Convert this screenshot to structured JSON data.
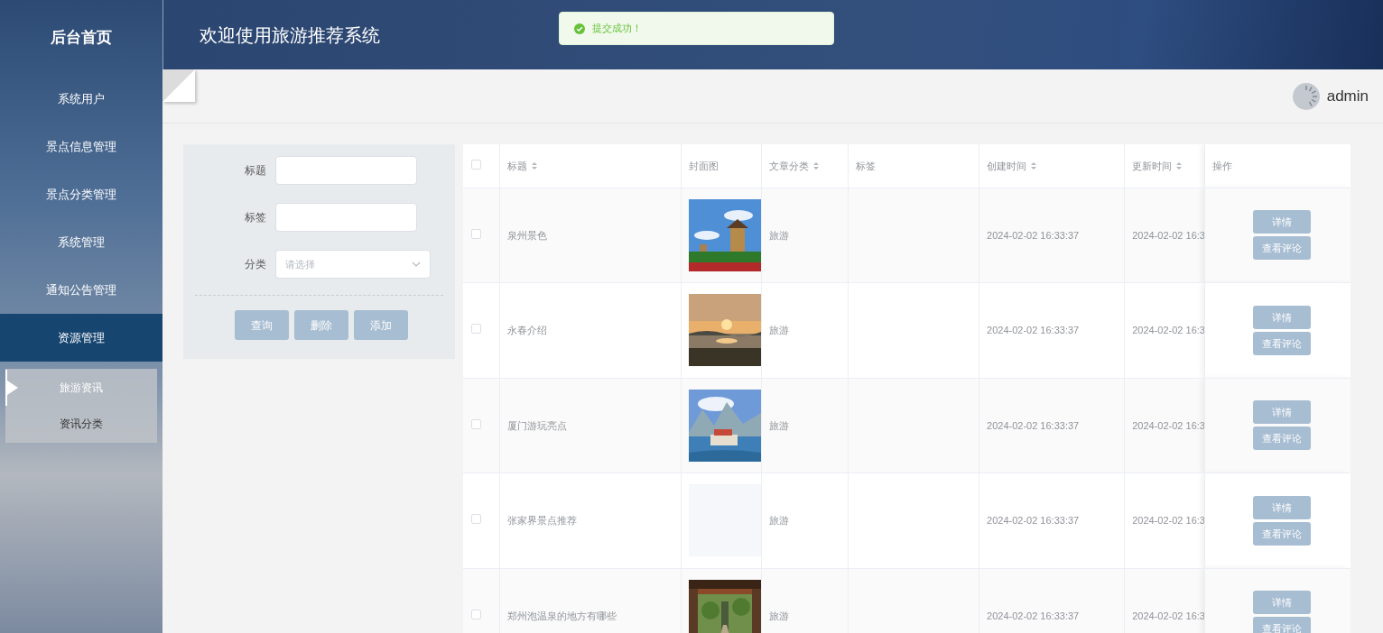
{
  "sidebar": {
    "title": "后台首页",
    "items": [
      {
        "label": "系统用户",
        "selected": false
      },
      {
        "label": "景点信息管理",
        "selected": false
      },
      {
        "label": "景点分类管理",
        "selected": false
      },
      {
        "label": "系统管理",
        "selected": false
      },
      {
        "label": "通知公告管理",
        "selected": false
      },
      {
        "label": "资源管理",
        "selected": true,
        "children": [
          {
            "label": "旅游资讯",
            "selected": true
          },
          {
            "label": "资讯分类",
            "selected": false
          }
        ]
      }
    ]
  },
  "header": {
    "title": "欢迎使用旅游推荐系统"
  },
  "toast": {
    "kind": "success",
    "text": "提交成功！"
  },
  "user": {
    "name": "admin"
  },
  "search_form": {
    "fields": [
      {
        "kind": "input",
        "label": "标题"
      },
      {
        "kind": "input",
        "label": "标签"
      },
      {
        "kind": "select",
        "label": "分类",
        "placeholder": "请选择"
      }
    ],
    "buttons": [
      "查询",
      "删除",
      "添加"
    ]
  },
  "table": {
    "all_checked": false,
    "columns": [
      {
        "label": "标题",
        "sortable": true
      },
      {
        "label": "封面图",
        "sortable": false
      },
      {
        "label": "文章分类",
        "sortable": true
      },
      {
        "label": "标签",
        "sortable": false
      },
      {
        "label": "创建时间",
        "sortable": true
      },
      {
        "label": "更新时间",
        "sortable": true
      },
      {
        "label": "操作",
        "sortable": false
      }
    ],
    "rows": [
      {
        "checked": false,
        "title": "泉州景色",
        "cover": {
          "kind": "picture"
        },
        "category": "旅游",
        "created": "2024-02-02 16:33:37",
        "updated": "2024-02-02 16:3",
        "actions": [
          "详情",
          "查看评论"
        ]
      },
      {
        "checked": false,
        "title": "永春介绍",
        "cover": {
          "kind": "picture"
        },
        "category": "旅游",
        "created": "2024-02-02 16:33:37",
        "updated": "2024-02-02 16:3",
        "actions": [
          "详情",
          "查看评论"
        ]
      },
      {
        "checked": false,
        "title": "厦门游玩亮点",
        "cover": {
          "kind": "picture"
        },
        "category": "旅游",
        "created": "2024-02-02 16:33:37",
        "updated": "2024-02-02 16:3",
        "actions": [
          "详情",
          "查看评论"
        ]
      },
      {
        "checked": false,
        "title": "张家界景点推荐",
        "cover": {
          "kind": "empty"
        },
        "category": "旅游",
        "created": "2024-02-02 16:33:37",
        "updated": "2024-02-02 16:3",
        "actions": [
          "详情",
          "查看评论"
        ]
      },
      {
        "checked": false,
        "title": "郑州泡温泉的地方有哪些",
        "cover": {
          "kind": "picture"
        },
        "category": "旅游",
        "created": "2024-02-02 16:33:37",
        "updated": "2024-02-02 16:3",
        "actions": [
          "详情",
          "查看评论"
        ]
      }
    ]
  }
}
